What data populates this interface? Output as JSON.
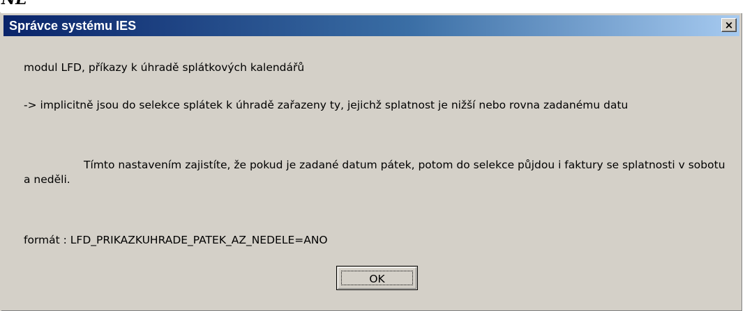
{
  "overlay": {
    "top_text": "NE"
  },
  "dialog": {
    "title": "Správce systému IES",
    "close_glyph": "×",
    "messages": [
      "modul LFD, příkazy k úhradě splátkových kalendářů",
      "-> implicitně jsou do selekce splátek k úhradě zařazeny ty, jejichž splatnost je nižší nebo rovna zadanému datu",
      "Tímto nastavením zajistíte, že pokud je zadané datum pátek, potom do selekce půjdou i faktury se splatnosti v sobotu a neděli.",
      "formát : LFD_PRIKAZKUHRADE_PATEK_AZ_NEDELE=ANO"
    ],
    "ok_label": "OK"
  },
  "colors": {
    "title_gradient_start": "#0a246a",
    "title_gradient_end": "#a6caf0",
    "dialog_background": "#d4d0c8"
  }
}
